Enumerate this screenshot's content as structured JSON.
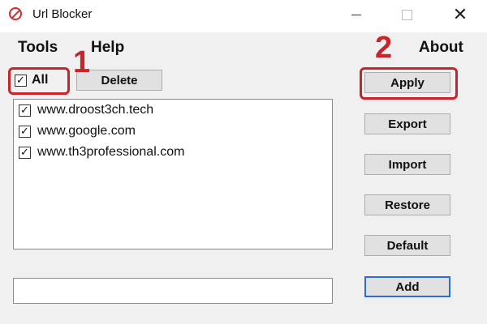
{
  "window": {
    "title": "Url Blocker",
    "controls": {
      "minimize": "minimize",
      "maximize": "maximize",
      "close": "✕"
    }
  },
  "menu": {
    "tools": "Tools",
    "help": "Help",
    "about": "About"
  },
  "select_all": {
    "label": "All",
    "checked": true,
    "check_glyph": "✓"
  },
  "buttons": {
    "delete": "Delete",
    "apply": "Apply",
    "export": "Export",
    "import": "Import",
    "restore": "Restore",
    "default": "Default",
    "add": "Add"
  },
  "url_list": [
    {
      "url": "www.droost3ch.tech",
      "checked": true
    },
    {
      "url": "www.google.com",
      "checked": true
    },
    {
      "url": "www.th3professional.com",
      "checked": true
    }
  ],
  "url_input": {
    "value": "",
    "placeholder": ""
  },
  "annotations": {
    "marker_1": "1",
    "marker_2": "2",
    "color": "#c9232b"
  }
}
